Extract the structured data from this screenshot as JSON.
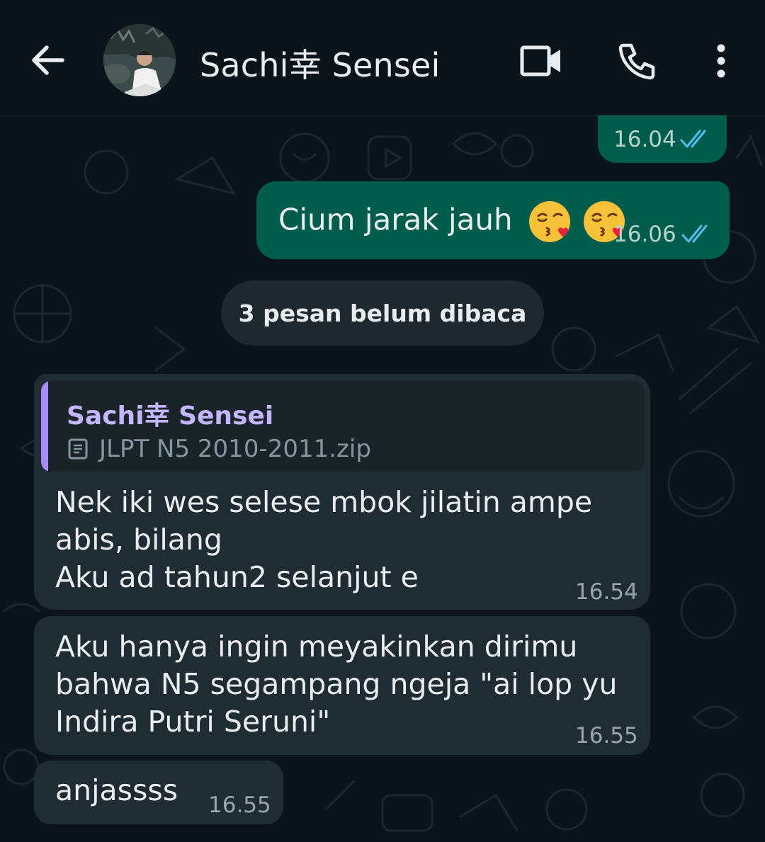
{
  "header": {
    "contact_name": "Sachi幸 Sensei"
  },
  "messages": [
    {
      "id": "m1",
      "direction": "outgoing",
      "time": "16.04",
      "status": "read"
    },
    {
      "id": "m2",
      "direction": "outgoing",
      "text": "Cium jarak jauh",
      "emojis": [
        "kissing-face-with-heart-emoji",
        "kissing-face-with-heart-emoji"
      ],
      "time": "16.06",
      "status": "read"
    },
    {
      "id": "m3",
      "direction": "incoming",
      "reply_to": {
        "author": "Sachi幸 Sensei",
        "file_name": "JLPT N5 2010-2011.zip"
      },
      "lines": [
        "Nek iki wes selese mbok jilatin ampe",
        "abis, bilang",
        "Aku ad tahun2 selanjut e"
      ],
      "time": "16.54"
    },
    {
      "id": "m4",
      "direction": "incoming",
      "lines": [
        "Aku hanya ingin meyakinkan dirimu",
        "bahwa N5 segampang ngeja \"ai lop yu",
        "Indira Putri Seruni\""
      ],
      "time": "16.55"
    },
    {
      "id": "m5",
      "direction": "incoming",
      "text": "anjassss",
      "time": "16.55"
    }
  ],
  "unread_banner": "3 pesan belum dibaca",
  "colors": {
    "background": "#0b141a",
    "outgoing_bubble": "#005c4b",
    "incoming_bubble": "#202c33",
    "read_ticks": "#53bdeb",
    "quote_accent": "#a78bfa"
  }
}
